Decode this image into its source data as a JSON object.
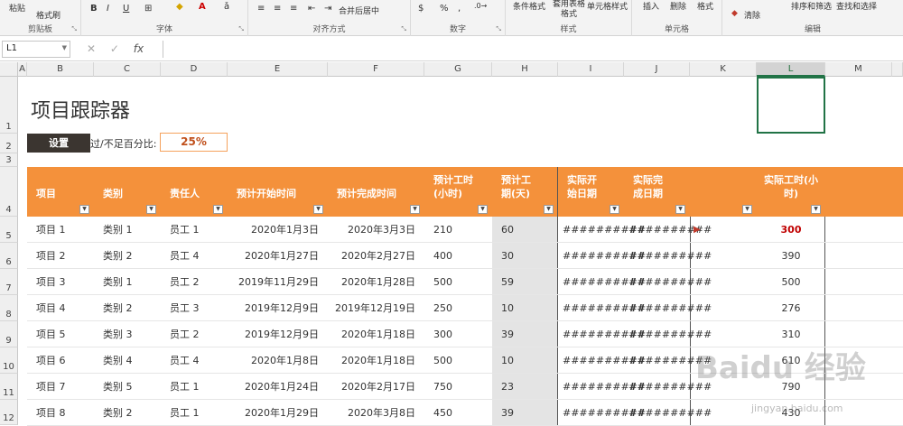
{
  "ribbon": {
    "groups": [
      {
        "label": "剪贴板",
        "buttons": [
          "粘贴",
          "格式刷"
        ]
      },
      {
        "label": "字体",
        "buttons": [
          "B",
          "I",
          "U"
        ]
      },
      {
        "label": "对齐方式",
        "buttons": [
          "合并后居中"
        ]
      },
      {
        "label": "数字",
        "buttons": [
          "%"
        ]
      },
      {
        "label": "样式",
        "buttons": [
          "条件格式",
          "套用表格格式",
          "单元格样式"
        ]
      },
      {
        "label": "单元格",
        "buttons": [
          "插入",
          "删除",
          "格式"
        ]
      },
      {
        "label": "编辑",
        "buttons": [
          "清除",
          "排序和筛选",
          "查找和选择"
        ]
      }
    ]
  },
  "formula_bar": {
    "name_box": "L1",
    "fx": "fx",
    "value": ""
  },
  "columns": [
    "A",
    "B",
    "C",
    "D",
    "E",
    "F",
    "G",
    "H",
    "I",
    "J",
    "K",
    "L",
    "M"
  ],
  "selected_column": "L",
  "rows": [
    "1",
    "2",
    "3",
    "4",
    "5",
    "6",
    "7",
    "8",
    "9",
    "10",
    "11",
    "12"
  ],
  "sheet": {
    "title": "项目跟踪器",
    "settings_label": "设置",
    "pct_label": "过/不足百分比:",
    "pct_value": "25%"
  },
  "table": {
    "headers": [
      "项目",
      "类别",
      "责任人",
      "预计开始时间",
      "预计完成时间",
      "预计工时(小时)",
      "预计工期(天)",
      "实际开始日期",
      "实际完成日期",
      "",
      "实际工时(小时)"
    ],
    "rows": [
      {
        "project": "项目 1",
        "category": "类别 1",
        "owner": "员工 1",
        "est_start": "2020年1月3日",
        "est_end": "2020年3月3日",
        "est_hours": "210",
        "est_days": "60",
        "act_start": "##########",
        "act_end": "##########",
        "flag": "▶",
        "act_hours": "300",
        "over": true
      },
      {
        "project": "项目 2",
        "category": "类别 2",
        "owner": "员工 4",
        "est_start": "2020年1月27日",
        "est_end": "2020年2月27日",
        "est_hours": "400",
        "est_days": "30",
        "act_start": "##########",
        "act_end": "##########",
        "flag": "",
        "act_hours": "390",
        "over": false
      },
      {
        "project": "项目 3",
        "category": "类别 1",
        "owner": "员工 2",
        "est_start": "2019年11月29日",
        "est_end": "2020年1月28日",
        "est_hours": "500",
        "est_days": "59",
        "act_start": "##########",
        "act_end": "##########",
        "flag": "",
        "act_hours": "500",
        "over": false
      },
      {
        "project": "项目 4",
        "category": "类别 2",
        "owner": "员工 3",
        "est_start": "2019年12月9日",
        "est_end": "2019年12月19日",
        "est_hours": "250",
        "est_days": "10",
        "act_start": "##########",
        "act_end": "##########",
        "flag": "",
        "act_hours": "276",
        "over": false
      },
      {
        "project": "项目 5",
        "category": "类别 3",
        "owner": "员工 2",
        "est_start": "2019年12月9日",
        "est_end": "2020年1月18日",
        "est_hours": "300",
        "est_days": "39",
        "act_start": "##########",
        "act_end": "##########",
        "flag": "",
        "act_hours": "310",
        "over": false
      },
      {
        "project": "项目 6",
        "category": "类别 4",
        "owner": "员工 4",
        "est_start": "2020年1月8日",
        "est_end": "2020年1月18日",
        "est_hours": "500",
        "est_days": "10",
        "act_start": "##########",
        "act_end": "##########",
        "flag": "",
        "act_hours": "610",
        "over": false
      },
      {
        "project": "项目 7",
        "category": "类别 5",
        "owner": "员工 1",
        "est_start": "2020年1月24日",
        "est_end": "2020年2月17日",
        "est_hours": "750",
        "est_days": "23",
        "act_start": "##########",
        "act_end": "##########",
        "flag": "",
        "act_hours": "790",
        "over": false
      },
      {
        "project": "项目 8",
        "category": "类别 2",
        "owner": "员工 1",
        "est_start": "2020年1月29日",
        "est_end": "2020年3月8日",
        "est_hours": "450",
        "est_days": "39",
        "act_start": "##########",
        "act_end": "##########",
        "flag": "",
        "act_hours": "430",
        "over": false
      }
    ]
  },
  "watermark": {
    "logo": "Baidu 经验",
    "url": "jingyan.baidu.com"
  },
  "colors": {
    "header": "#f4913b",
    "accent": "#217346",
    "over": "#c00000"
  }
}
